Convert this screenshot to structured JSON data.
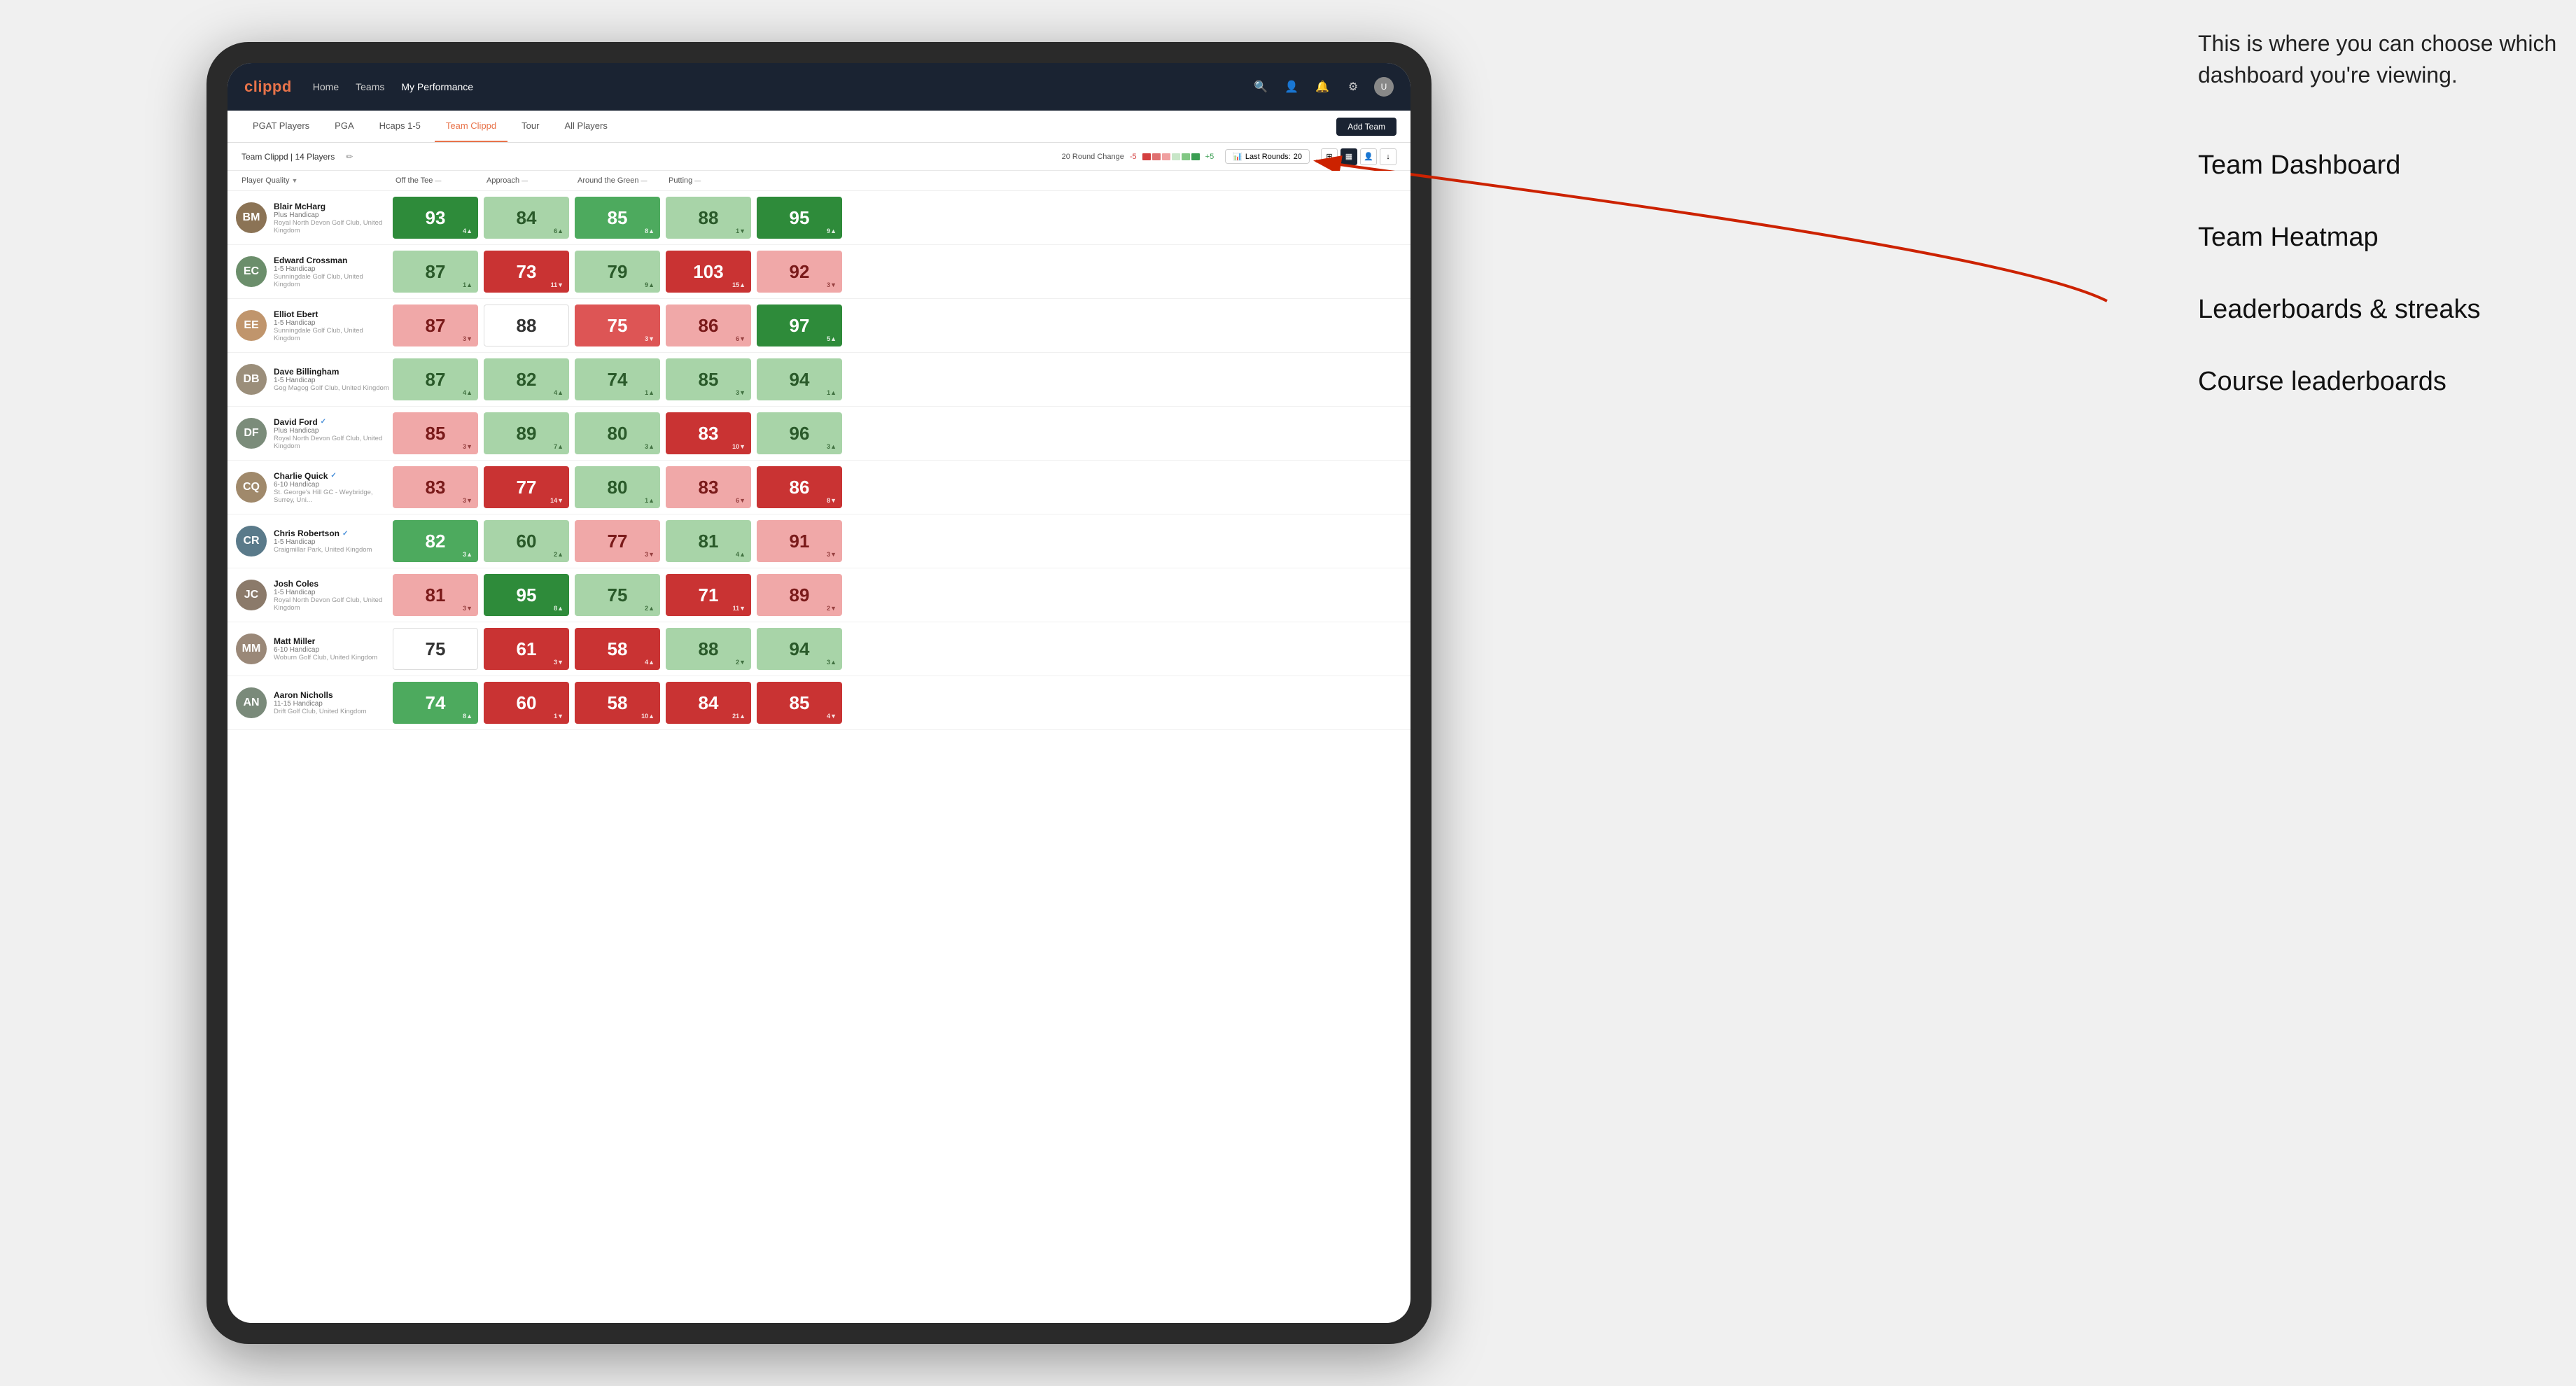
{
  "annotation": {
    "intro": "This is where you can choose which dashboard you're viewing.",
    "items": [
      "Team Dashboard",
      "Team Heatmap",
      "Leaderboards & streaks",
      "Course leaderboards"
    ]
  },
  "nav": {
    "logo": "clippd",
    "links": [
      "Home",
      "Teams",
      "My Performance"
    ],
    "active_link": "My Performance"
  },
  "tabs": {
    "items": [
      "PGAT Players",
      "PGA",
      "Hcaps 1-5",
      "Team Clippd",
      "Tour",
      "All Players"
    ],
    "active": "Team Clippd",
    "add_button": "Add Team"
  },
  "sub_header": {
    "team_name": "Team Clippd",
    "player_count": "14 Players",
    "round_change_label": "20 Round Change",
    "change_neg": "-5",
    "change_pos": "+5",
    "last_rounds_label": "Last Rounds:",
    "last_rounds_value": "20"
  },
  "columns": {
    "headers": [
      "Player Quality ↓",
      "Off the Tee ↓",
      "Approach ↓",
      "Around the Green ↓",
      "Putting ↓"
    ]
  },
  "players": [
    {
      "name": "Blair McHarg",
      "handicap": "Plus Handicap",
      "club": "Royal North Devon Golf Club, United Kingdom",
      "initials": "BM",
      "avatar_color": "#8B7355",
      "scores": [
        {
          "value": 93,
          "delta": "4▲",
          "color": "green-dark"
        },
        {
          "value": 84,
          "delta": "6▲",
          "color": "green-light"
        },
        {
          "value": 85,
          "delta": "8▲",
          "color": "green-med"
        },
        {
          "value": 88,
          "delta": "1▼",
          "color": "green-light"
        },
        {
          "value": 95,
          "delta": "9▲",
          "color": "green-dark"
        }
      ]
    },
    {
      "name": "Edward Crossman",
      "handicap": "1-5 Handicap",
      "club": "Sunningdale Golf Club, United Kingdom",
      "initials": "EC",
      "avatar_color": "#6B8E6B",
      "scores": [
        {
          "value": 87,
          "delta": "1▲",
          "color": "green-light"
        },
        {
          "value": 73,
          "delta": "11▼",
          "color": "red-dark"
        },
        {
          "value": 79,
          "delta": "9▲",
          "color": "green-light"
        },
        {
          "value": 103,
          "delta": "15▲",
          "color": "red-dark"
        },
        {
          "value": 92,
          "delta": "3▼",
          "color": "red-light"
        }
      ]
    },
    {
      "name": "Elliot Ebert",
      "handicap": "1-5 Handicap",
      "club": "Sunningdale Golf Club, United Kingdom",
      "initials": "EE",
      "avatar_color": "#c0956c",
      "scores": [
        {
          "value": 87,
          "delta": "3▼",
          "color": "red-light"
        },
        {
          "value": 88,
          "delta": "",
          "color": "white"
        },
        {
          "value": 75,
          "delta": "3▼",
          "color": "red-med"
        },
        {
          "value": 86,
          "delta": "6▼",
          "color": "red-light"
        },
        {
          "value": 97,
          "delta": "5▲",
          "color": "green-dark"
        }
      ]
    },
    {
      "name": "Dave Billingham",
      "handicap": "1-5 Handicap",
      "club": "Gog Magog Golf Club, United Kingdom",
      "initials": "DB",
      "avatar_color": "#9B8E7A",
      "scores": [
        {
          "value": 87,
          "delta": "4▲",
          "color": "green-light"
        },
        {
          "value": 82,
          "delta": "4▲",
          "color": "green-light"
        },
        {
          "value": 74,
          "delta": "1▲",
          "color": "green-light"
        },
        {
          "value": 85,
          "delta": "3▼",
          "color": "green-light"
        },
        {
          "value": 94,
          "delta": "1▲",
          "color": "green-light"
        }
      ]
    },
    {
      "name": "David Ford",
      "handicap": "Plus Handicap",
      "club": "Royal North Devon Golf Club, United Kingdom",
      "initials": "DF",
      "avatar_color": "#7B8C7A",
      "verified": true,
      "scores": [
        {
          "value": 85,
          "delta": "3▼",
          "color": "red-light"
        },
        {
          "value": 89,
          "delta": "7▲",
          "color": "green-light"
        },
        {
          "value": 80,
          "delta": "3▲",
          "color": "green-light"
        },
        {
          "value": 83,
          "delta": "10▼",
          "color": "red-dark"
        },
        {
          "value": 96,
          "delta": "3▲",
          "color": "green-light"
        }
      ]
    },
    {
      "name": "Charlie Quick",
      "handicap": "6-10 Handicap",
      "club": "St. George's Hill GC - Weybridge, Surrey, Uni...",
      "initials": "CQ",
      "avatar_color": "#A0896B",
      "verified": true,
      "scores": [
        {
          "value": 83,
          "delta": "3▼",
          "color": "red-light"
        },
        {
          "value": 77,
          "delta": "14▼",
          "color": "red-dark"
        },
        {
          "value": 80,
          "delta": "1▲",
          "color": "green-light"
        },
        {
          "value": 83,
          "delta": "6▼",
          "color": "red-light"
        },
        {
          "value": 86,
          "delta": "8▼",
          "color": "red-dark"
        }
      ]
    },
    {
      "name": "Chris Robertson",
      "handicap": "1-5 Handicap",
      "club": "Craigmillar Park, United Kingdom",
      "initials": "CR",
      "avatar_color": "#5A7A8A",
      "verified": true,
      "scores": [
        {
          "value": 82,
          "delta": "3▲",
          "color": "green-med"
        },
        {
          "value": 60,
          "delta": "2▲",
          "color": "green-light"
        },
        {
          "value": 77,
          "delta": "3▼",
          "color": "red-light"
        },
        {
          "value": 81,
          "delta": "4▲",
          "color": "green-light"
        },
        {
          "value": 91,
          "delta": "3▼",
          "color": "red-light"
        }
      ]
    },
    {
      "name": "Josh Coles",
      "handicap": "1-5 Handicap",
      "club": "Royal North Devon Golf Club, United Kingdom",
      "initials": "JC",
      "avatar_color": "#8B7A6A",
      "scores": [
        {
          "value": 81,
          "delta": "3▼",
          "color": "red-light"
        },
        {
          "value": 95,
          "delta": "8▲",
          "color": "green-dark"
        },
        {
          "value": 75,
          "delta": "2▲",
          "color": "green-light"
        },
        {
          "value": 71,
          "delta": "11▼",
          "color": "red-dark"
        },
        {
          "value": 89,
          "delta": "2▼",
          "color": "red-light"
        }
      ]
    },
    {
      "name": "Matt Miller",
      "handicap": "6-10 Handicap",
      "club": "Woburn Golf Club, United Kingdom",
      "initials": "MM",
      "avatar_color": "#9A8878",
      "scores": [
        {
          "value": 75,
          "delta": "",
          "color": "white"
        },
        {
          "value": 61,
          "delta": "3▼",
          "color": "red-dark"
        },
        {
          "value": 58,
          "delta": "4▲",
          "color": "red-dark"
        },
        {
          "value": 88,
          "delta": "2▼",
          "color": "green-light"
        },
        {
          "value": 94,
          "delta": "3▲",
          "color": "green-light"
        }
      ]
    },
    {
      "name": "Aaron Nicholls",
      "handicap": "11-15 Handicap",
      "club": "Drift Golf Club, United Kingdom",
      "initials": "AN",
      "avatar_color": "#7A8A7A",
      "scores": [
        {
          "value": 74,
          "delta": "8▲",
          "color": "green-med"
        },
        {
          "value": 60,
          "delta": "1▼",
          "color": "red-dark"
        },
        {
          "value": 58,
          "delta": "10▲",
          "color": "red-dark"
        },
        {
          "value": 84,
          "delta": "21▲",
          "color": "red-dark"
        },
        {
          "value": 85,
          "delta": "4▼",
          "color": "red-dark"
        }
      ]
    }
  ]
}
